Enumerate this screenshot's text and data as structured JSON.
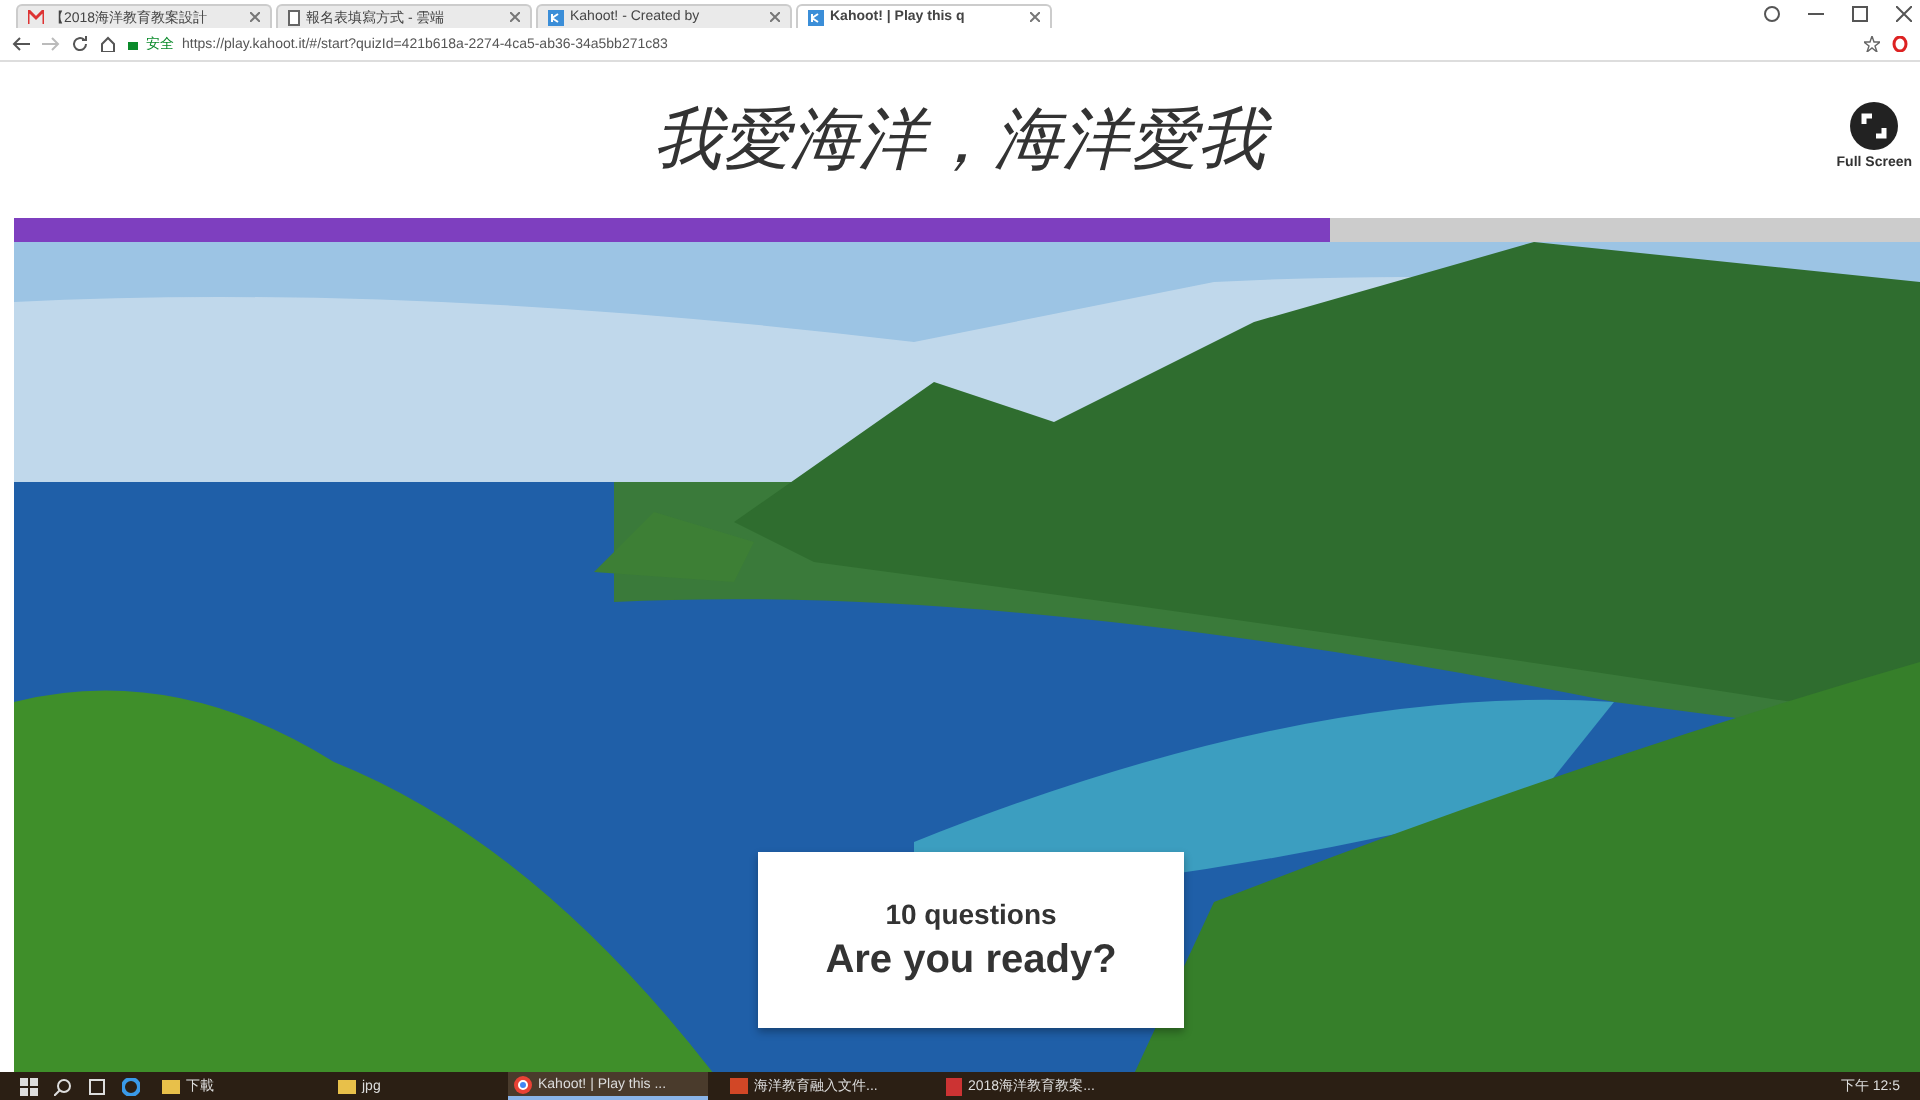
{
  "browser": {
    "tabs": [
      {
        "label": "【2018海洋教育教案設計",
        "kind": "mail",
        "selected": false
      },
      {
        "label": "報名表填寫方式 - 雲端",
        "kind": "doc",
        "selected": false
      },
      {
        "label": "Kahoot! - Created by",
        "kind": "kahoot",
        "selected": false
      },
      {
        "label": "Kahoot! | Play this q",
        "kind": "kahoot",
        "selected": true
      }
    ],
    "secure_label": "安全",
    "url": "https://play.kahoot.it/#/start?quizId=421b618a-2274-4ca5-ab36-34a5bb271c83"
  },
  "quiz": {
    "title": "我愛海洋，海洋愛我",
    "fullscreen_label": "Full Screen",
    "progress": {
      "level": 0.69
    },
    "card": {
      "count": "10 questions",
      "prompt": "Are you ready?"
    }
  },
  "taskbar": {
    "items": [
      {
        "label": "下載",
        "kind": "folder",
        "active": false
      },
      {
        "label": "jpg",
        "kind": "folder",
        "active": false
      },
      {
        "label": "Kahoot! | Play this ...",
        "kind": "chrome",
        "active": true
      },
      {
        "label": "海洋教育融入文件...",
        "kind": "ppt",
        "active": false
      },
      {
        "label": "2018海洋教育教案...",
        "kind": "pdf",
        "active": false
      }
    ],
    "clock": "下午 12:5"
  }
}
